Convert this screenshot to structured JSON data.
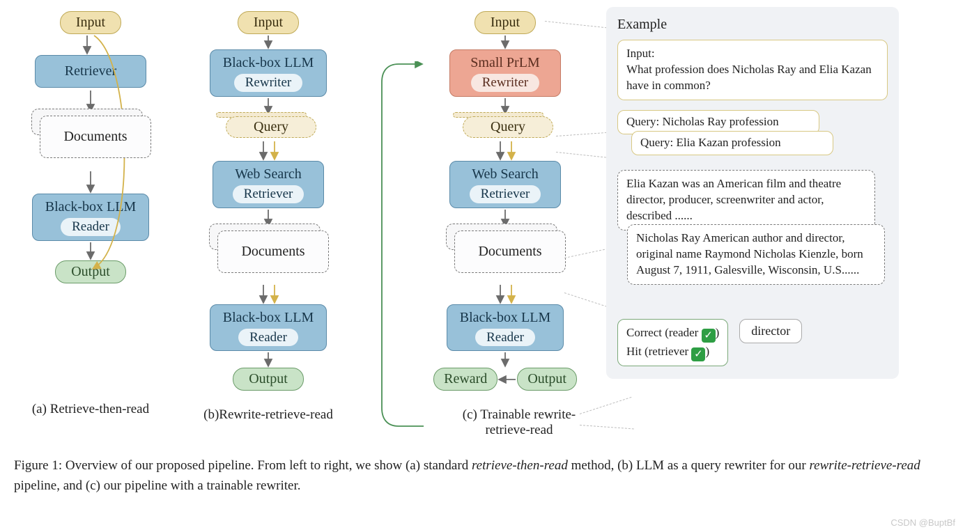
{
  "colors": {
    "beige": "#f0e1b0",
    "blue": "#98c1d9",
    "coral": "#eda693",
    "green": "#c9e3c7",
    "dashed_border": "#7a7a7a"
  },
  "col_a": {
    "input": "Input",
    "retriever": "Retriever",
    "documents": "Documents",
    "llm": "Black-box LLM",
    "reader": "Reader",
    "output": "Output",
    "caption": "(a) Retrieve-then-read"
  },
  "col_b": {
    "input": "Input",
    "llm_top": "Black-box LLM",
    "rewriter": "Rewriter",
    "query": "Query",
    "web_search": "Web Search",
    "retriever": "Retriever",
    "documents": "Documents",
    "llm_bottom": "Black-box LLM",
    "reader": "Reader",
    "output": "Output",
    "caption": "(b)Rewrite-retrieve-read"
  },
  "col_c": {
    "input": "Input",
    "small_prlm": "Small PrLM",
    "rewriter": "Rewriter",
    "query": "Query",
    "web_search": "Web Search",
    "retriever": "Retriever",
    "documents": "Documents",
    "llm": "Black-box LLM",
    "reader": "Reader",
    "reward": "Reward",
    "output": "Output",
    "caption": "(c) Trainable rewrite-retrieve-read"
  },
  "example": {
    "title": "Example",
    "input_label": "Input:",
    "input_text": "What profession does Nicholas Ray and Elia Kazan have in common?",
    "query1": "Query: Nicholas Ray profession",
    "query2": "Query: Elia Kazan profession",
    "doc1": "Elia Kazan was an American film and theatre director, producer, screenwriter and actor, described  ......",
    "doc2": "Nicholas Ray American author and director, original name Raymond Nicholas Kienzle, born August 7, 1911, Galesville, Wisconsin, U.S......",
    "correct_label": "Correct (reader ",
    "hit_label": "Hit (retriever ",
    "paren_close": ")",
    "director": "director"
  },
  "figure_caption": {
    "prefix": "Figure 1:  Overview of our proposed pipeline. From left to right, we show (a) standard ",
    "ital1": "retrieve-then-read",
    "mid1": " method, (b) LLM as a query rewriter for our ",
    "ital2": "rewrite-retrieve-read",
    "mid2": " pipeline, and (c) our pipeline with a trainable rewriter."
  },
  "watermark": "CSDN @BuptBf"
}
